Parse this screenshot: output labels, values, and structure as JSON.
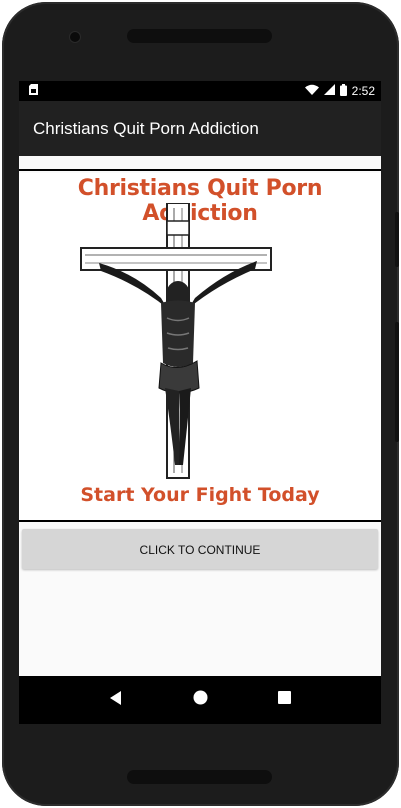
{
  "status_bar": {
    "time": "2:52"
  },
  "app_bar": {
    "title": "Christians Quit Porn Addiction"
  },
  "banner": {
    "title": "Christians Quit Porn Addiction",
    "subtitle": "Start Your Fight Today"
  },
  "continue_button": {
    "label": "CLICK TO CONTINUE"
  },
  "colors": {
    "banner_text": "#d2502a",
    "app_bar": "#212121",
    "button": "#d6d6d6"
  },
  "icons": [
    "sim-card-icon",
    "wifi-icon",
    "signal-icon",
    "battery-icon",
    "back-icon",
    "home-icon",
    "recents-icon",
    "crucifix-image"
  ]
}
